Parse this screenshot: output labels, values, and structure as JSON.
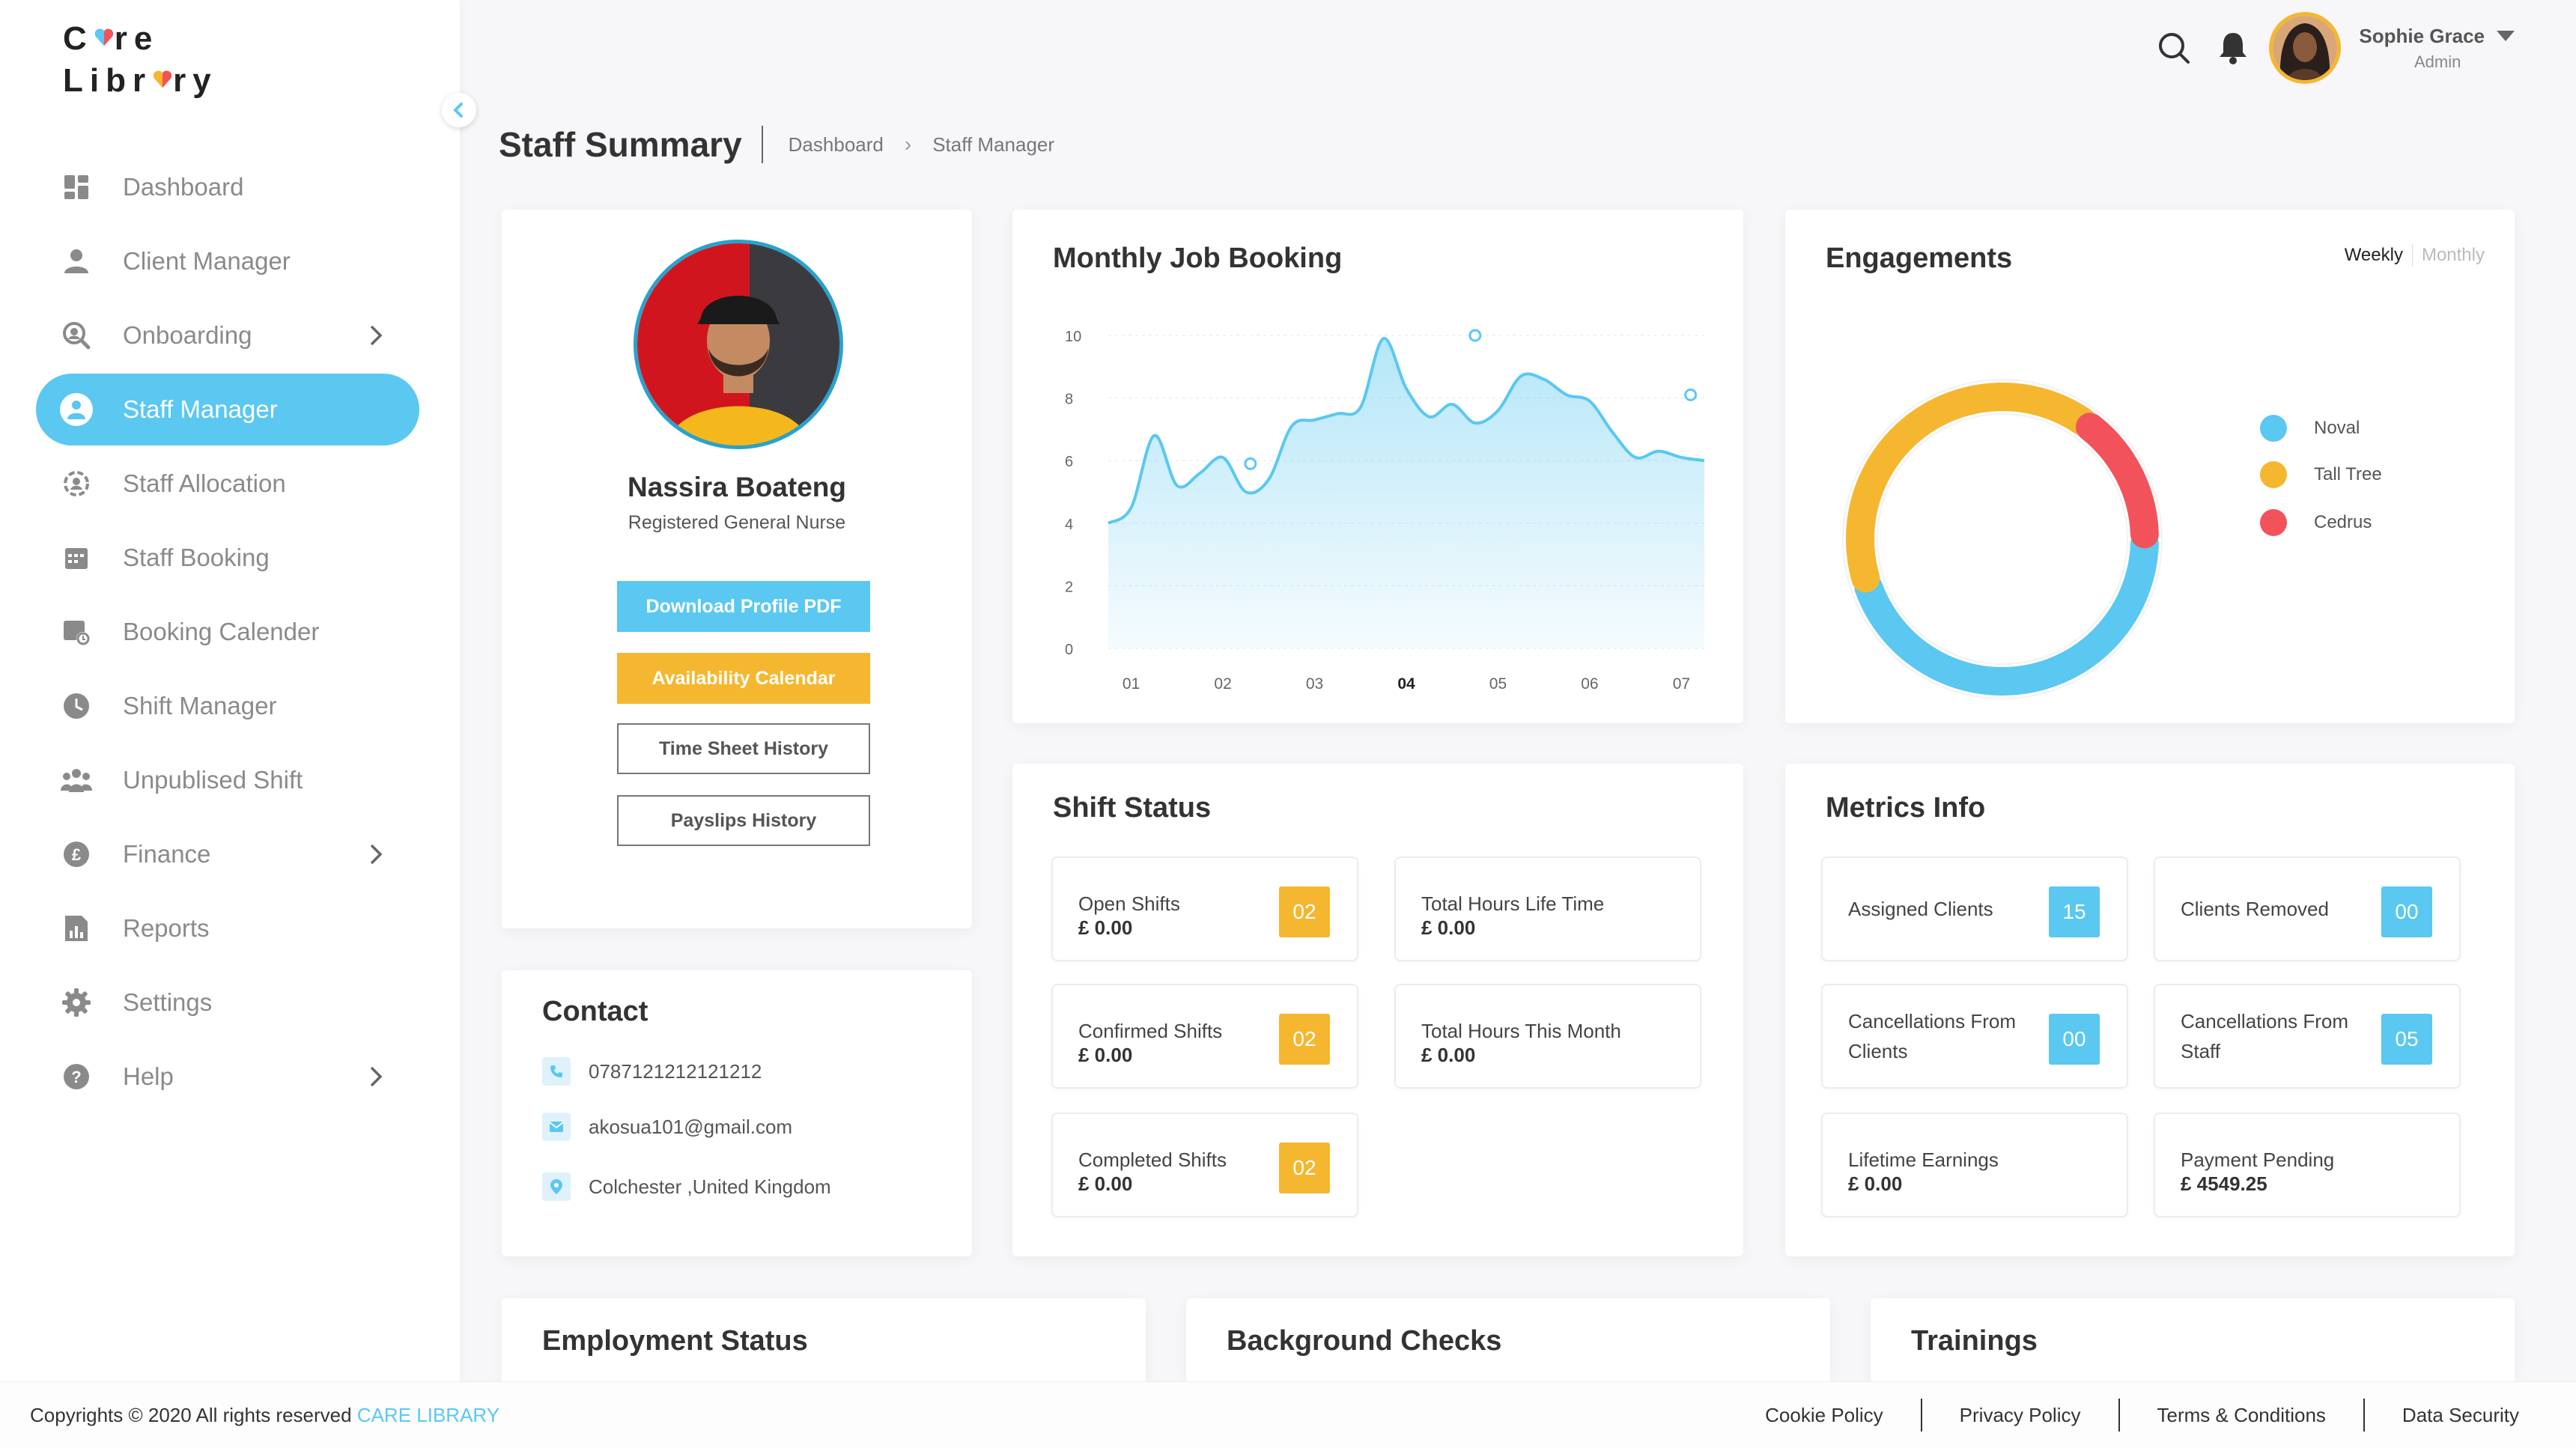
{
  "app": {
    "logo_line1": "Care",
    "logo_line2": "Library"
  },
  "sidebar": {
    "items": [
      {
        "label": "Dashboard",
        "icon": "dashboard-icon"
      },
      {
        "label": "Client Manager",
        "icon": "client-icon"
      },
      {
        "label": "Onboarding",
        "icon": "onboarding-icon",
        "chevron": true
      },
      {
        "label": "Staff Manager",
        "icon": "staff-icon",
        "active": true
      },
      {
        "label": "Staff Allocation",
        "icon": "allocation-icon"
      },
      {
        "label": "Staff Booking",
        "icon": "booking-icon"
      },
      {
        "label": "Booking Calender",
        "icon": "calendar-icon"
      },
      {
        "label": "Shift Manager",
        "icon": "clock-icon"
      },
      {
        "label": "Unpublised Shift",
        "icon": "group-icon"
      },
      {
        "label": "Finance",
        "icon": "pound-icon",
        "chevron": true
      },
      {
        "label": "Reports",
        "icon": "report-icon"
      },
      {
        "label": "Settings",
        "icon": "gear-icon"
      },
      {
        "label": "Help",
        "icon": "help-icon",
        "chevron": true
      }
    ]
  },
  "topbar": {
    "user_name": "Sophie Grace",
    "user_role": "Admin"
  },
  "header": {
    "title": "Staff Summary",
    "breadcrumb": [
      "Dashboard",
      "Staff Manager"
    ]
  },
  "profile": {
    "name": "Nassira Boateng",
    "role": "Registered General Nurse",
    "buttons": {
      "download": "Download Profile PDF",
      "availability": "Availability Calendar",
      "timesheet": "Time Sheet History",
      "payslips": "Payslips History"
    }
  },
  "contact": {
    "title": "Contact",
    "phone": "0787121212121212",
    "email": "akosua101@gmail.com",
    "location": "Colchester ,United Kingdom"
  },
  "monthly_booking": {
    "title": "Monthly Job Booking"
  },
  "engagements": {
    "title": "Engagements",
    "tabs": [
      "Weekly",
      "Monthly"
    ],
    "active_tab": "Weekly"
  },
  "chart_data": [
    {
      "type": "area",
      "title": "Monthly Job Booking",
      "x": [
        "01",
        "02",
        "03",
        "04",
        "05",
        "06",
        "07"
      ],
      "highlighted_x": "04",
      "ylim": [
        0,
        10
      ],
      "yticks": [
        0,
        2,
        4,
        6,
        8,
        10
      ],
      "grid": true,
      "color": "#5ac8f0",
      "series": [
        {
          "x": [
            0.75,
            1.0,
            1.25,
            1.5,
            1.75,
            2.0,
            2.25,
            2.5,
            2.75,
            3.0,
            3.25,
            3.5,
            3.75,
            4.0,
            4.25,
            4.5,
            4.75,
            5.0,
            5.25,
            5.5,
            5.75,
            6.0,
            6.25,
            6.5,
            6.75,
            7.0,
            7.25
          ],
          "y": [
            4.0,
            4.5,
            6.8,
            5.2,
            5.6,
            6.1,
            5.0,
            5.4,
            7.1,
            7.3,
            7.5,
            7.7,
            9.9,
            8.3,
            7.4,
            7.8,
            7.2,
            7.6,
            8.7,
            8.6,
            8.1,
            7.9,
            6.9,
            6.1,
            6.3,
            6.1,
            6.0
          ]
        }
      ],
      "markers": [
        {
          "x": 2.3,
          "y": 5.9
        },
        {
          "x": 4.75,
          "y": 10.0
        },
        {
          "x": 7.1,
          "y": 8.1
        }
      ]
    },
    {
      "type": "pie",
      "title": "Engagements",
      "labels": [
        "Noval",
        "Tall Tree",
        "Cedrus"
      ],
      "values": [
        45,
        40,
        15
      ],
      "colors": [
        "#5ac8f0",
        "#f5b72f",
        "#f2525a"
      ],
      "legend": "right"
    }
  ],
  "shift_status": {
    "title": "Shift Status",
    "items": [
      {
        "label": "Open Shifts",
        "value": "£ 0.00",
        "badge": "02"
      },
      {
        "label": "Total Hours Life Time",
        "value": "£ 0.00"
      },
      {
        "label": "Confirmed Shifts",
        "value": "£ 0.00",
        "badge": "02"
      },
      {
        "label": "Total Hours This Month",
        "value": "£ 0.00"
      },
      {
        "label": "Completed Shifts",
        "value": "£ 0.00",
        "badge": "02"
      }
    ]
  },
  "metrics": {
    "title": "Metrics Info",
    "items": [
      {
        "label": "Assigned Clients",
        "badge": "15"
      },
      {
        "label": "Clients Removed",
        "badge": "00"
      },
      {
        "label": "Cancellations From Clients",
        "badge": "00"
      },
      {
        "label": "Cancellations From Staff",
        "badge": "05"
      },
      {
        "label": "Lifetime Earnings",
        "value": "£ 0.00"
      },
      {
        "label": "Payment Pending",
        "value": "£ 4549.25"
      }
    ]
  },
  "bottom_cards": {
    "employment": "Employment Status",
    "background": "Background Checks",
    "trainings": "Trainings"
  },
  "footer": {
    "copyright": "Copyrights © 2020  All rights reserved ",
    "brand": "CARE LIBRARY",
    "links": [
      "Cookie Policy",
      "Privacy Policy",
      "Terms & Conditions",
      "Data Security"
    ]
  },
  "colors": {
    "accent": "#5ac8f0",
    "orange": "#f5b72f",
    "red": "#f2525a"
  }
}
